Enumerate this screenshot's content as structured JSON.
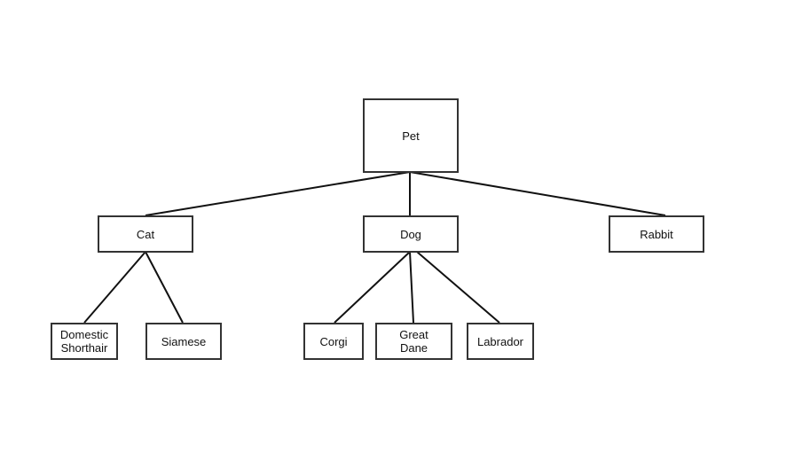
{
  "diagram": {
    "type": "tree",
    "nodes": [
      {
        "id": "pet",
        "label": "Pet"
      },
      {
        "id": "cat",
        "label": "Cat"
      },
      {
        "id": "dog",
        "label": "Dog"
      },
      {
        "id": "rabbit",
        "label": "Rabbit"
      },
      {
        "id": "domestic-shorthair",
        "label": "Domestic\nShorthair"
      },
      {
        "id": "siamese",
        "label": "Siamese"
      },
      {
        "id": "corgi",
        "label": "Corgi"
      },
      {
        "id": "great-dane",
        "label": "Great\nDane"
      },
      {
        "id": "labrador",
        "label": "Labrador"
      }
    ],
    "edges": [
      {
        "from": "pet",
        "to": "cat"
      },
      {
        "from": "pet",
        "to": "dog"
      },
      {
        "from": "pet",
        "to": "rabbit"
      },
      {
        "from": "cat",
        "to": "domestic-shorthair"
      },
      {
        "from": "cat",
        "to": "siamese"
      },
      {
        "from": "dog",
        "to": "corgi"
      },
      {
        "from": "dog",
        "to": "great-dane"
      },
      {
        "from": "dog",
        "to": "labrador"
      }
    ],
    "line_color": "#111111",
    "border_color": "#333333"
  }
}
